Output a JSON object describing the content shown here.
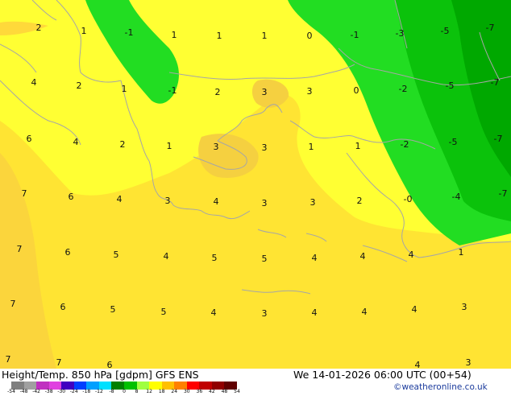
{
  "map": {
    "contour_labels": [
      {
        "text": "2",
        "near": "top-left"
      }
    ],
    "colors": {
      "field_yellow": "#ffff33",
      "field_light_orange": "#ffe433",
      "field_orange": "#fbd53c",
      "field_green": "#22dd22",
      "field_dark_green": "#0bc20b",
      "field_darker_green": "#00a800",
      "coastline": "#a6a6a6"
    }
  },
  "footer": {
    "title": "Height/Temp. 850 hPa [gdpm] GFS ENS",
    "valid_time": "We 14-01-2026 06:00 UTC (00+54)",
    "credit": "©weatheronline.co.uk",
    "colorbar_ticks": [
      "-54",
      "-48",
      "-42",
      "-38",
      "-30",
      "-24",
      "-18",
      "-12",
      "-8",
      "0",
      "8",
      "12",
      "18",
      "24",
      "30",
      "36",
      "42",
      "48",
      "54"
    ],
    "colorbar_colors": [
      "#7f7f7f",
      "#a0a0a0",
      "#c030c0",
      "#e040e0",
      "#4000c0",
      "#0040ff",
      "#00a0ff",
      "#00e0ff",
      "#008000",
      "#00c000",
      "#a0ff40",
      "#ffff00",
      "#ffc000",
      "#ff8000",
      "#ff0000",
      "#c00000",
      "#900000",
      "#600000"
    ]
  }
}
